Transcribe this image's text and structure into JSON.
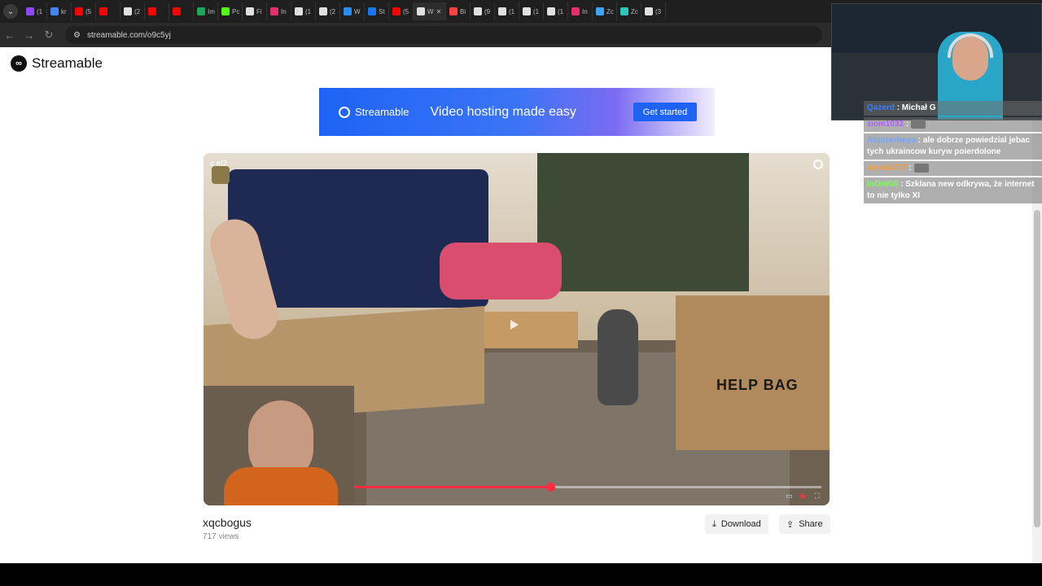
{
  "browser": {
    "tabs": [
      {
        "label": "(1",
        "color": "#9146ff"
      },
      {
        "label": "kr",
        "color": "#4285f4"
      },
      {
        "label": "(5",
        "color": "#ff0000"
      },
      {
        "label": "",
        "color": "#ff0000"
      },
      {
        "label": "(2",
        "color": "#e0e0e0"
      },
      {
        "label": "",
        "color": "#ff0000"
      },
      {
        "label": "",
        "color": "#ff0000"
      },
      {
        "label": "Im",
        "color": "#1da75b"
      },
      {
        "label": "Pc",
        "color": "#53fc18"
      },
      {
        "label": "Fi",
        "color": "#e0e0e0"
      },
      {
        "label": "In",
        "color": "#e1306c"
      },
      {
        "label": "(1",
        "color": "#e0e0e0"
      },
      {
        "label": "(2",
        "color": "#e0e0e0"
      },
      {
        "label": "W",
        "color": "#2a8bf2"
      },
      {
        "label": "St",
        "color": "#1877f2"
      },
      {
        "label": "(5",
        "color": "#ff0000"
      },
      {
        "label": "W",
        "color": "#e0e0e0",
        "active": true
      },
      {
        "label": "Bi",
        "color": "#ff4040"
      },
      {
        "label": "(9",
        "color": "#e0e0e0"
      },
      {
        "label": "(1",
        "color": "#e0e0e0"
      },
      {
        "label": "(1",
        "color": "#e0e0e0"
      },
      {
        "label": "(1",
        "color": "#e0e0e0"
      },
      {
        "label": "In",
        "color": "#e1306c"
      },
      {
        "label": "Zc",
        "color": "#3da5ff"
      },
      {
        "label": "Zc",
        "color": "#2ec4b6"
      },
      {
        "label": "(3",
        "color": "#e0e0e0"
      }
    ],
    "url": "streamable.com/o9c5yj"
  },
  "site": {
    "logo_text": "Streamable",
    "banner": {
      "brand": "Streamable",
      "tagline": "Video hosting made easy",
      "cta": "Get started"
    },
    "video": {
      "channel": "c   el2",
      "box_text": "HELP BAG",
      "progress": 0.42
    },
    "title": "xqcbogus",
    "views": "717 views",
    "download_label": "Download",
    "share_label": "Share"
  },
  "stream_chat": [
    {
      "user": "Qazerd",
      "user_color": "#3a7bff",
      "text": ": Michał G"
    },
    {
      "user": "ziom1032",
      "user_color": "#b05cff",
      "text": ":"
    },
    {
      "user": "Abjuzerhoya",
      "user_color": "#6ea8ff",
      "text": ": ale dobrze powiedzial jebac tych ukraincow kuryw poierdolone"
    },
    {
      "user": "wenaX777",
      "user_color": "#ff9a2e",
      "text": ":"
    },
    {
      "user": "InOnKill",
      "user_color": "#7dff5a",
      "text": ": Szklana new odkrywa, że internet to nie tylko XI"
    }
  ]
}
